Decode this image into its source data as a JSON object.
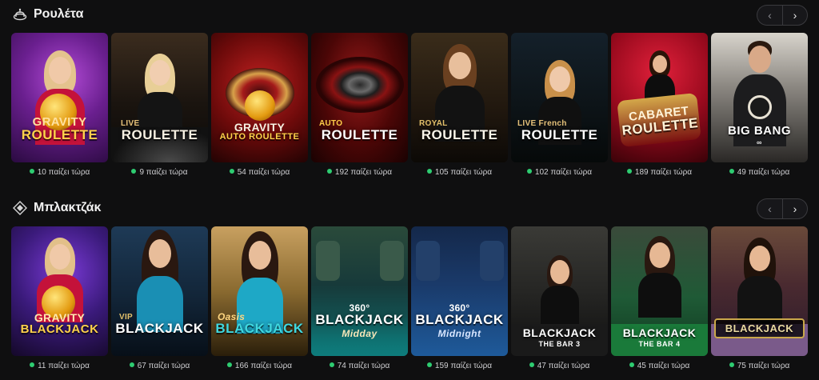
{
  "sections": [
    {
      "title": "Ρουλέτα",
      "icon": "roulette-icon",
      "prev_arrow": "‹",
      "next_arrow": "›",
      "games": [
        {
          "line1": "GRAVITY",
          "line2": "ROULETTE",
          "line3": "",
          "players": "10 παίζει τώρα"
        },
        {
          "line1": "LIVE",
          "line2": "ROULETTE",
          "line3": "",
          "players": "9 παίζει τώρα"
        },
        {
          "line1": "GRAVITY",
          "line2": "AUTO ROULETTE",
          "line3": "",
          "players": "54 παίζει τώρα"
        },
        {
          "line1": "AUTO",
          "line2": "ROULETTE",
          "line3": "",
          "players": "192 παίζει τώρα"
        },
        {
          "line1": "ROYAL",
          "line2": "ROULETTE",
          "line3": "",
          "players": "105 παίζει τώρα"
        },
        {
          "line1": "LIVE French",
          "line2": "ROULETTE",
          "line3": "",
          "players": "102 παίζει τώρα"
        },
        {
          "line1": "CABARET",
          "line2": "ROULETTE",
          "line3": "",
          "players": "189 παίζει τώρα"
        },
        {
          "line1": "",
          "line2": "BIG BANG",
          "line3": "",
          "players": "49 παίζει τώρα"
        }
      ]
    },
    {
      "title": "Μπλακτζάκ",
      "icon": "diamond-icon",
      "prev_arrow": "‹",
      "next_arrow": "›",
      "games": [
        {
          "line1": "GRAVITY",
          "line2": "BLACKJACK",
          "line3": "",
          "players": "11 παίζει τώρα"
        },
        {
          "line1": "VIP",
          "line2": "BLACKJACK",
          "line3": "",
          "players": "67 παίζει τώρα"
        },
        {
          "line1": "Oasis",
          "line2": "BLACKJACK",
          "line3": "",
          "players": "166 παίζει τώρα"
        },
        {
          "line1": "360°",
          "line2": "BLACKJACK",
          "line3": "Midday",
          "players": "74 παίζει τώρα"
        },
        {
          "line1": "360°",
          "line2": "BLACKJACK",
          "line3": "Midnight",
          "players": "159 παίζει τώρα"
        },
        {
          "line1": "",
          "line2": "BLACKJACK",
          "line3": "THE BAR 3",
          "players": "47 παίζει τώρα"
        },
        {
          "line1": "",
          "line2": "BLACKJACK",
          "line3": "THE BAR 4",
          "players": "45 παίζει τώρα"
        },
        {
          "line1": "",
          "line2": "BLACKJACK",
          "line3": "",
          "players": "75 παίζει τώρα"
        }
      ]
    }
  ]
}
